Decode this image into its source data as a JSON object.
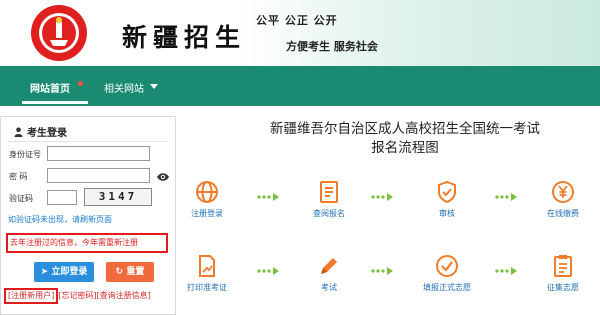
{
  "header": {
    "logo_text": "新疆招生",
    "brand": "新疆招生",
    "slogan_line1": "公平 公正 公开",
    "slogan_line2": "方便考生   服务社会"
  },
  "nav": {
    "home": "网站首页",
    "related": "相关网站"
  },
  "login": {
    "title": "考生登录",
    "id_label": "身份证号",
    "password_label": "密    码",
    "captcha_label": "验证码",
    "captcha_value": "3147",
    "refresh_hint": "如验证码未出现，请刷新页面",
    "notice": "去年注册过的信息，今年需重新注册",
    "login_button": "立即登录",
    "reset_button": "重置",
    "link_register": "[注册新用户]",
    "link_forgot": "[忘记密码]",
    "link_query": "[查询注册信息]"
  },
  "main": {
    "title_line1": "新疆维吾尔自治区成人高校招生全国统一考试",
    "title_line2": "报名流程图"
  },
  "flow": {
    "steps": [
      {
        "label": "注册登录",
        "icon": "globe-icon"
      },
      {
        "label": "查阅报名",
        "icon": "document-icon"
      },
      {
        "label": "审核",
        "icon": "shield-check-icon"
      },
      {
        "label": "在线缴费",
        "icon": "yuan-coin-icon"
      },
      {
        "label": "打印准考证",
        "icon": "print-document-icon"
      },
      {
        "label": "考试",
        "icon": "pencil-icon"
      },
      {
        "label": "填报正式志愿",
        "icon": "check-circle-icon"
      },
      {
        "label": "征集志愿",
        "icon": "form-list-icon"
      }
    ]
  },
  "colors": {
    "nav_bg": "#1a8a72",
    "icon_orange": "#f07c2a",
    "notice_red": "#e21c1c",
    "link_blue": "#1e6fb8",
    "login_btn": "#2b8fe0",
    "reset_btn": "#f06a3b",
    "arrow_green": "#7bbf3d"
  }
}
